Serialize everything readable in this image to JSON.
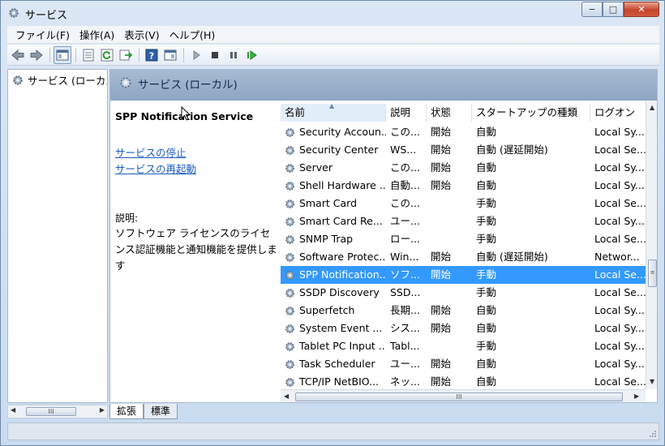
{
  "window": {
    "title": "サービス",
    "minimize": "−",
    "maximize": "□",
    "close": "✕"
  },
  "menu": [
    "ファイル(F)",
    "操作(A)",
    "表示(V)",
    "ヘルプ(H)"
  ],
  "tree": {
    "root_label": "サービス (ローカル)"
  },
  "header": {
    "title": "サービス (ローカル)"
  },
  "detail": {
    "service_name": "SPP Notification Service",
    "stop_link": "サービスの停止",
    "restart_link": "サービスの再起動",
    "description_label": "説明:",
    "description": "ソフトウェア ライセンスのライセンス認証機能と通知機能を提供します"
  },
  "columns": [
    "名前",
    "説明",
    "状態",
    "スタートアップの種類",
    "ログオン"
  ],
  "rows": [
    {
      "name": "Security Accoun...",
      "desc": "この...",
      "status": "開始",
      "startup": "自動",
      "logon": "Local Sy..."
    },
    {
      "name": "Security Center",
      "desc": "WS...",
      "status": "開始",
      "startup": "自動 (遅延開始)",
      "logon": "Local Se..."
    },
    {
      "name": "Server",
      "desc": "この...",
      "status": "開始",
      "startup": "自動",
      "logon": "Local Sy..."
    },
    {
      "name": "Shell Hardware ...",
      "desc": "自動...",
      "status": "開始",
      "startup": "自動",
      "logon": "Local Sy..."
    },
    {
      "name": "Smart Card",
      "desc": "この...",
      "status": "",
      "startup": "手動",
      "logon": "Local Se..."
    },
    {
      "name": "Smart Card Re...",
      "desc": "ユー...",
      "status": "",
      "startup": "手動",
      "logon": "Local Sy..."
    },
    {
      "name": "SNMP Trap",
      "desc": "ロー...",
      "status": "",
      "startup": "手動",
      "logon": "Local Se..."
    },
    {
      "name": "Software Protec...",
      "desc": "Win...",
      "status": "開始",
      "startup": "自動 (遅延開始)",
      "logon": "Networ..."
    },
    {
      "name": "SPP Notification...",
      "desc": "ソフ...",
      "status": "開始",
      "startup": "手動",
      "logon": "Local Se..."
    },
    {
      "name": "SSDP Discovery",
      "desc": "SSD...",
      "status": "",
      "startup": "手動",
      "logon": "Local Se..."
    },
    {
      "name": "Superfetch",
      "desc": "長期...",
      "status": "開始",
      "startup": "自動",
      "logon": "Local Sy..."
    },
    {
      "name": "System Event ...",
      "desc": "シス...",
      "status": "開始",
      "startup": "自動",
      "logon": "Local Sy..."
    },
    {
      "name": "Tablet PC Input ...",
      "desc": "Tabl...",
      "status": "",
      "startup": "手動",
      "logon": "Local Sy..."
    },
    {
      "name": "Task Scheduler",
      "desc": "ユー...",
      "status": "開始",
      "startup": "自動",
      "logon": "Local Sy..."
    },
    {
      "name": "TCP/IP NetBIO...",
      "desc": "ネッ...",
      "status": "開始",
      "startup": "自動",
      "logon": "Local Se..."
    }
  ],
  "selected_row": 8,
  "tabs": [
    "拡張",
    "標準"
  ],
  "scroll": {
    "grip": "III",
    "vgrip": "≡"
  },
  "colors": {
    "selection": "#3399ff",
    "link": "#1d5bbd",
    "header": "#98afc9"
  }
}
